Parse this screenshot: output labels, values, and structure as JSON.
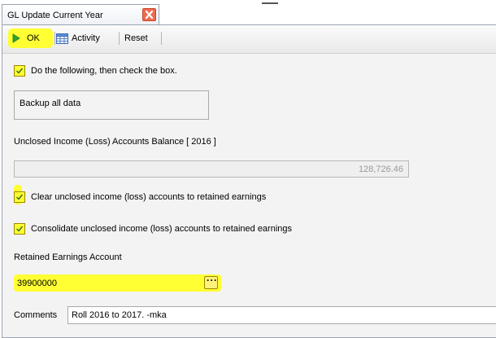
{
  "tab": {
    "title": "GL Update Current Year"
  },
  "toolbar": {
    "ok_label": "OK",
    "activity_label": "Activity",
    "reset_label": "Reset"
  },
  "instructions": {
    "checkbox_label": "Do the following, then check the box.",
    "checked": true,
    "box_text": "Backup all data"
  },
  "balance": {
    "label": "Unclosed Income (Loss) Accounts Balance [ 2016 ]",
    "value": "128,726.46"
  },
  "options": [
    {
      "label": "Clear unclosed income (loss) accounts to retained earnings",
      "checked": true
    },
    {
      "label": "Consolidate unclosed income (loss) accounts to retained earnings",
      "checked": true
    }
  ],
  "retained_earnings": {
    "label": "Retained Earnings Account",
    "value": "39900000"
  },
  "comments": {
    "label": "Comments",
    "value": "Roll 2016 to 2017. -mka"
  },
  "colors": {
    "highlight": "#ffff33",
    "close_red": "#ef6b4e"
  }
}
